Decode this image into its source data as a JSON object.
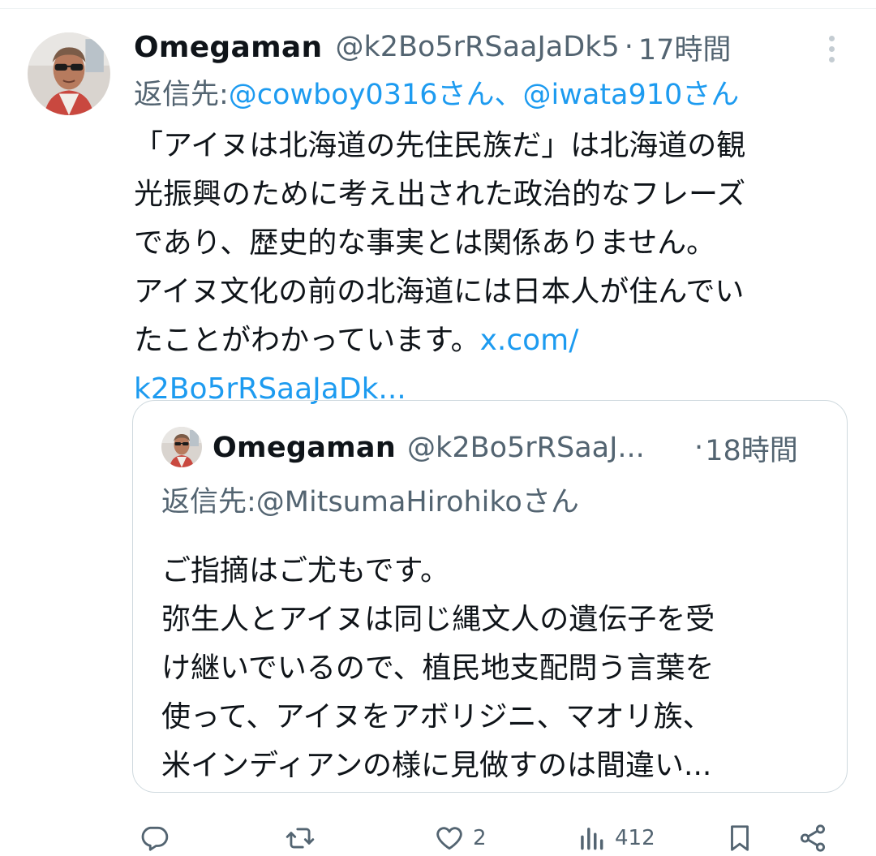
{
  "tweet": {
    "display_name": "Omegaman",
    "handle": "@k2Bo5rRSaaJaDk5",
    "separator": "·",
    "time": "17時間",
    "reply_prefix": "返信先: ",
    "reply_mentions": [
      "@cowboy0316さん",
      "@iwata910さん"
    ],
    "reply_separator": "、",
    "text_lines": [
      "「アイヌは北海道の先住民族だ」は北海道の観",
      "光振興のために考え出された政治的なフレーズ",
      "であり、歴史的な事実とは関係ありません。",
      "アイヌ文化の前の北海道には日本人が住んでい",
      "たことがわかっています。"
    ],
    "link_part1": "x.com/",
    "link_part2": "k2Bo5rRSaaJaDk..."
  },
  "quote": {
    "display_name": "Omegaman",
    "handle": "@k2Bo5rRSaaJ...",
    "separator": "·",
    "time": "18時間",
    "reply_prefix": "返信先: ",
    "reply_mention": "@MitsumaHirohikoさん",
    "text_lines": [
      "ご指摘はご尤もです。",
      "弥生人とアイヌは同じ縄文人の遺伝子を受",
      "け継いでいるので、植民地支配問う言葉を",
      "使って、アイヌをアボリジニ、マオリ族、",
      "米インディアンの様に見做すのは間違い..."
    ]
  },
  "actions": {
    "reply_icon": "reply-icon",
    "retweet_icon": "retweet-icon",
    "like_icon": "like-icon",
    "like_count": "2",
    "views_icon": "views-icon",
    "views_count": "412",
    "bookmark_icon": "bookmark-icon",
    "share_icon": "share-icon"
  },
  "colors": {
    "text": "#0f1419",
    "secondary": "#536471",
    "link": "#1d9bf0",
    "border": "#cfd9de"
  }
}
